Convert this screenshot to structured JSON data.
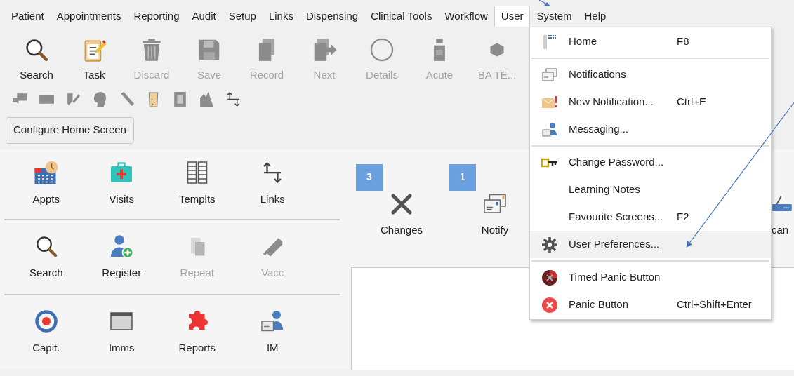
{
  "menu_bar": [
    {
      "label": "Patient",
      "selected": false
    },
    {
      "label": "Appointments",
      "selected": false
    },
    {
      "label": "Reporting",
      "selected": false
    },
    {
      "label": "Audit",
      "selected": false
    },
    {
      "label": "Setup",
      "selected": false
    },
    {
      "label": "Links",
      "selected": false
    },
    {
      "label": "Dispensing",
      "selected": false
    },
    {
      "label": "Clinical Tools",
      "selected": false
    },
    {
      "label": "Workflow",
      "selected": false
    },
    {
      "label": "User",
      "selected": true
    },
    {
      "label": "System",
      "selected": false
    },
    {
      "label": "Help",
      "selected": false
    }
  ],
  "toolbar": [
    {
      "label": "Search",
      "disabled": false
    },
    {
      "label": "Task",
      "disabled": false
    },
    {
      "label": "Discard",
      "disabled": true
    },
    {
      "label": "Save",
      "disabled": true
    },
    {
      "label": "Record",
      "disabled": true
    },
    {
      "label": "Next",
      "disabled": true
    },
    {
      "label": "Details",
      "disabled": true
    },
    {
      "label": "Acute",
      "disabled": true
    },
    {
      "label": "BA TE...",
      "disabled": true
    }
  ],
  "configure_button": "Configure Home Screen",
  "tile_groups": [
    [
      {
        "label": "Appts",
        "disabled": false
      },
      {
        "label": "Visits",
        "disabled": false
      },
      {
        "label": "Templts",
        "disabled": false
      },
      {
        "label": "Links",
        "disabled": false
      }
    ],
    [
      {
        "label": "Search",
        "disabled": false
      },
      {
        "label": "Register",
        "disabled": false
      },
      {
        "label": "Repeat",
        "disabled": true
      },
      {
        "label": "Vacc",
        "disabled": true
      }
    ],
    [
      {
        "label": "Capit.",
        "disabled": false
      },
      {
        "label": "Imms",
        "disabled": false
      },
      {
        "label": "Reports",
        "disabled": false
      },
      {
        "label": "IM",
        "disabled": false
      }
    ]
  ],
  "widgets": [
    {
      "badge": "3",
      "label": "Changes"
    },
    {
      "badge": "1",
      "label": "Notify"
    },
    {
      "label": "can"
    }
  ],
  "user_menu": {
    "sections": [
      [
        {
          "label": "Home",
          "shortcut": "F8",
          "selected": false
        }
      ],
      [
        {
          "label": "Notifications",
          "selected": false
        },
        {
          "label": "New Notification...",
          "shortcut": "Ctrl+E",
          "selected": false
        },
        {
          "label": "Messaging...",
          "selected": false
        }
      ],
      [
        {
          "label": "Change Password...",
          "selected": false
        },
        {
          "label": "Learning Notes",
          "selected": false
        },
        {
          "label": "Favourite Screens...",
          "shortcut": "F2",
          "selected": false
        },
        {
          "label": "User Preferences...",
          "selected": true
        }
      ],
      [
        {
          "label": "Timed Panic Button",
          "selected": false
        },
        {
          "label": "Panic Button",
          "shortcut": "Ctrl+Shift+Enter",
          "selected": false
        }
      ]
    ]
  }
}
